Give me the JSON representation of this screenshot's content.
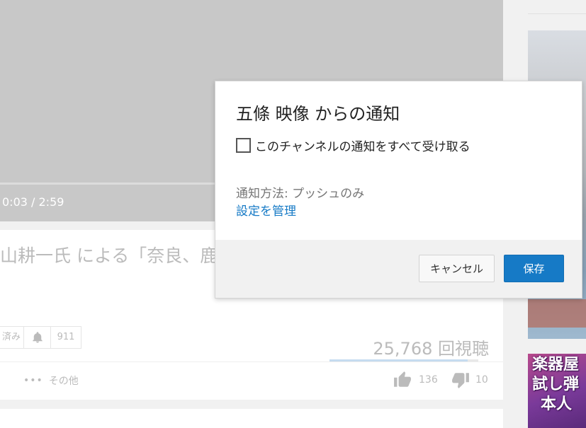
{
  "player": {
    "time": "0:03 / 2:59"
  },
  "video": {
    "title": "山耕一氏 による「奈良、鹿",
    "subscribe_status": "済み",
    "subscriber_count": "911",
    "view_count": "25,768 回視聴",
    "like_ratio": 0.93,
    "more_label": "その他",
    "more_dots": "•••",
    "likes": "136",
    "dislikes": "10"
  },
  "sidebar": {
    "thumb2_lines": [
      "楽器屋",
      "試し弾",
      "本人"
    ]
  },
  "dialog": {
    "title": "五條 映像 からの通知",
    "checkbox_label": "このチャンネルの通知をすべて受け取る",
    "checked": false,
    "method_text": "通知方法: プッシュのみ",
    "manage_link": "設定を管理",
    "cancel_label": "キャンセル",
    "save_label": "保存"
  },
  "colors": {
    "accent": "#167ac6",
    "overlay": "#c8c8c8"
  },
  "icons": {
    "bell": "bell-icon",
    "like": "thumbs-up-icon",
    "dislike": "thumbs-down-icon"
  }
}
